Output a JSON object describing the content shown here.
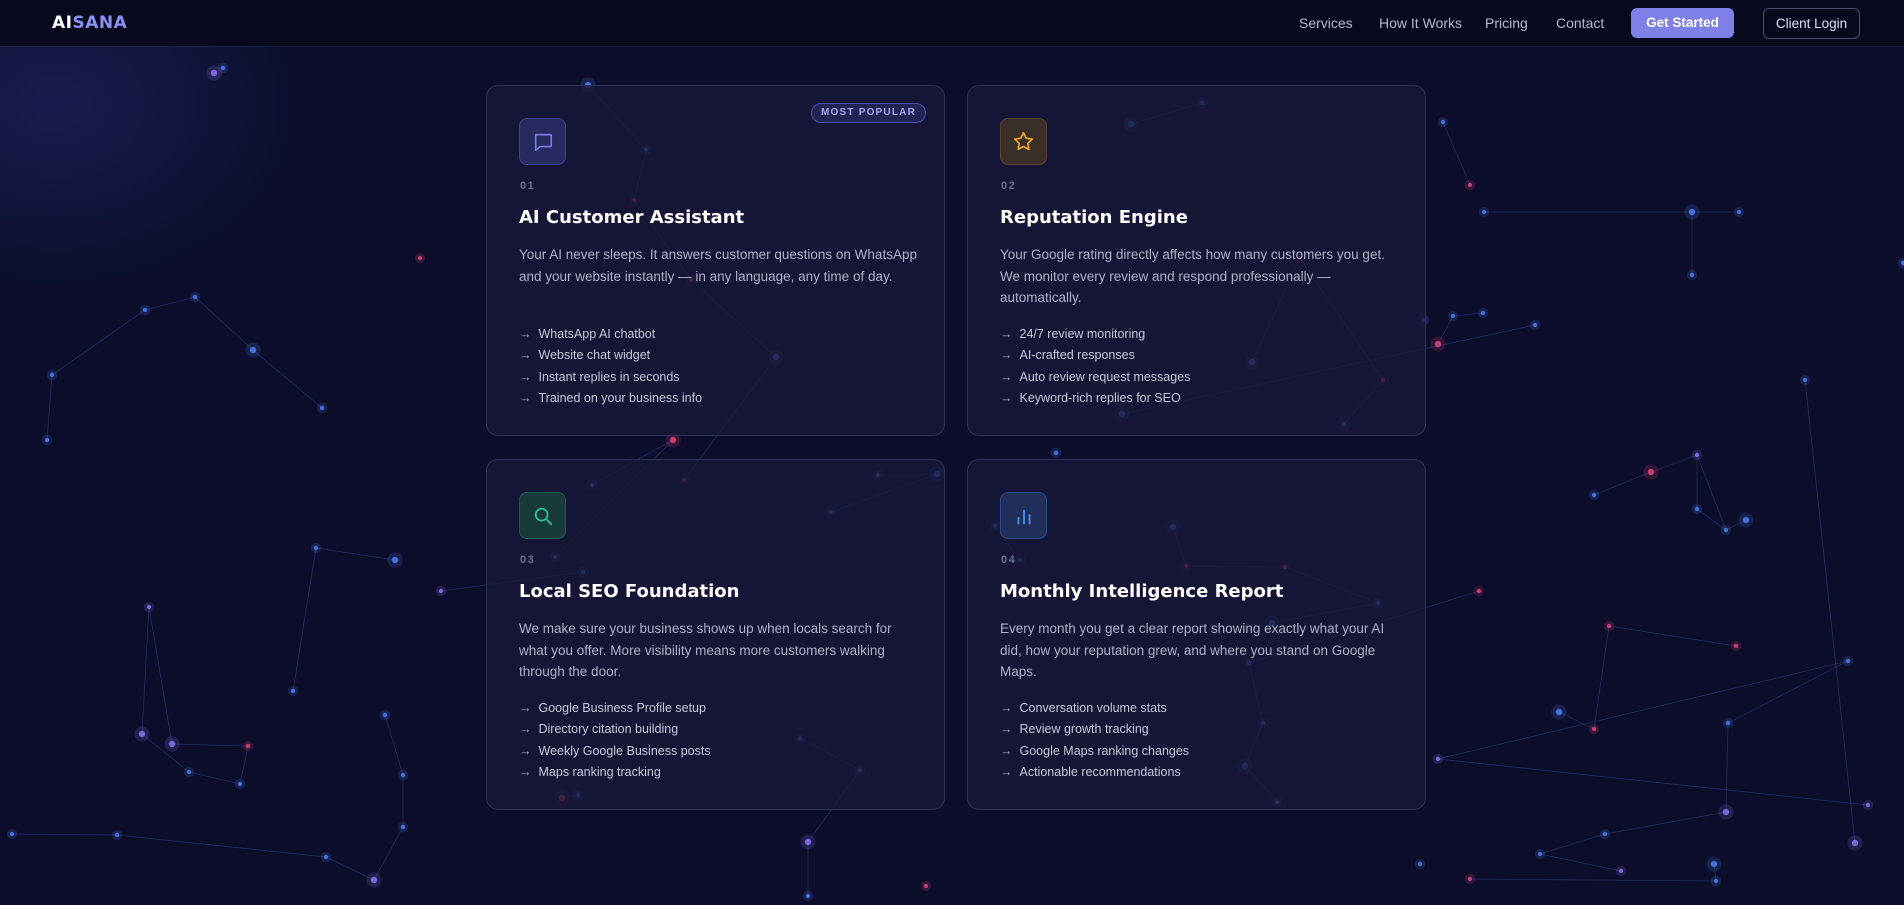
{
  "nav": {
    "logo_part1": "AI",
    "logo_part2": "SANA",
    "links": [
      "Services",
      "How It Works",
      "Pricing",
      "Contact"
    ],
    "primary_button": "Get Started",
    "secondary_button": "Client Login"
  },
  "cards": [
    {
      "number": "01",
      "icon": "chat-bubble-icon",
      "accent": "#7b7ff0",
      "badge": "MOST POPULAR",
      "title": "AI Customer Assistant",
      "description": "Your AI never sleeps. It answers customer questions on WhatsApp and your website instantly — in any language, any time of day.",
      "features": [
        "WhatsApp AI chatbot",
        "Website chat widget",
        "Instant replies in seconds",
        "Trained on your business info"
      ]
    },
    {
      "number": "02",
      "icon": "star-icon",
      "accent": "#f0a830",
      "title": "Reputation Engine",
      "description": "Your Google rating directly affects how many customers you get. We monitor every review and respond professionally — automatically.",
      "features": [
        "24/7 review monitoring",
        "AI-crafted responses",
        "Auto review request messages",
        "Keyword-rich replies for SEO"
      ]
    },
    {
      "number": "03",
      "icon": "search-icon",
      "accent": "#2fc99a",
      "title": "Local SEO Foundation",
      "description": "We make sure your business shows up when locals search for what you offer. More visibility means more customers walking through the door.",
      "features": [
        "Google Business Profile setup",
        "Directory citation building",
        "Weekly Google Business posts",
        "Maps ranking tracking"
      ]
    },
    {
      "number": "04",
      "icon": "bar-chart-icon",
      "accent": "#4f8ff0",
      "title": "Monthly Intelligence Report",
      "description": "Every month you get a clear report showing exactly what your AI did, how your reputation grew, and where you stand on Google Maps.",
      "features": [
        "Conversation volume stats",
        "Review growth tracking",
        "Google Maps ranking changes",
        "Actionable recommendations"
      ]
    }
  ]
}
